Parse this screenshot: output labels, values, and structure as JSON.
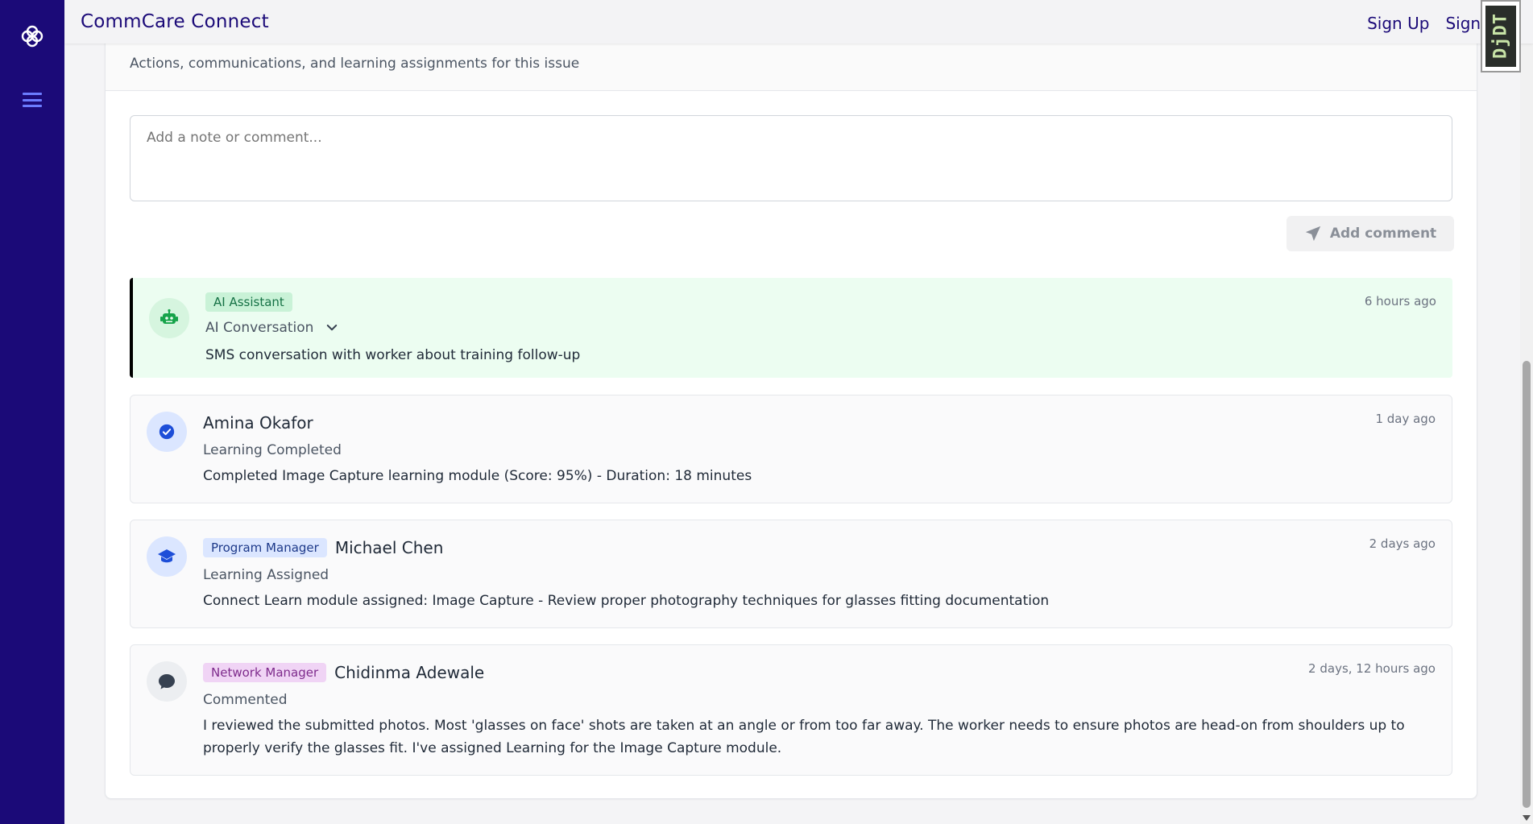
{
  "app": {
    "title": "CommCare Connect",
    "nav": [
      "Sign Up",
      "Sign In"
    ],
    "debug_badge": "DjDT"
  },
  "activity": {
    "subtitle": "Actions, communications, and learning assignments for this issue",
    "comment_placeholder": "Add a note or comment...",
    "add_comment_label": "Add comment"
  },
  "items": [
    {
      "type": "ai",
      "tag": "AI Assistant",
      "action": "AI Conversation",
      "description": "SMS conversation with worker about training follow-up",
      "timestamp": "6 hours ago",
      "icon": "robot-icon"
    },
    {
      "type": "learning-completed",
      "name": "Amina Okafor",
      "action": "Learning Completed",
      "description": "Completed Image Capture learning module (Score: 95%) - Duration: 18 minutes",
      "timestamp": "1 day ago",
      "icon": "check-circle-icon"
    },
    {
      "type": "learning-assigned",
      "tag": "Program Manager",
      "name": "Michael Chen",
      "action": "Learning Assigned",
      "description": "Connect Learn module assigned: Image Capture - Review proper photography techniques for glasses fitting documentation",
      "timestamp": "2 days ago",
      "icon": "graduation-cap-icon"
    },
    {
      "type": "comment",
      "tag": "Network Manager",
      "name": "Chidinma Adewale",
      "action": "Commented",
      "description": "I reviewed the submitted photos. Most 'glasses on face' shots are taken at an angle or from too far away. The worker needs to ensure photos are head-on from shoulders up to properly verify the glasses fit. I've assigned Learning for the Image Capture module.",
      "timestamp": "2 days, 12 hours ago",
      "icon": "chat-bubble-icon"
    }
  ],
  "colors": {
    "sidebar": "#1b0a78",
    "brand_text": "#1b0a78",
    "ai_background": "#ecfdf1",
    "tag_green": "#c9f2d7",
    "tag_blue": "#dbe6ff",
    "tag_purple": "#f0d4f5"
  }
}
